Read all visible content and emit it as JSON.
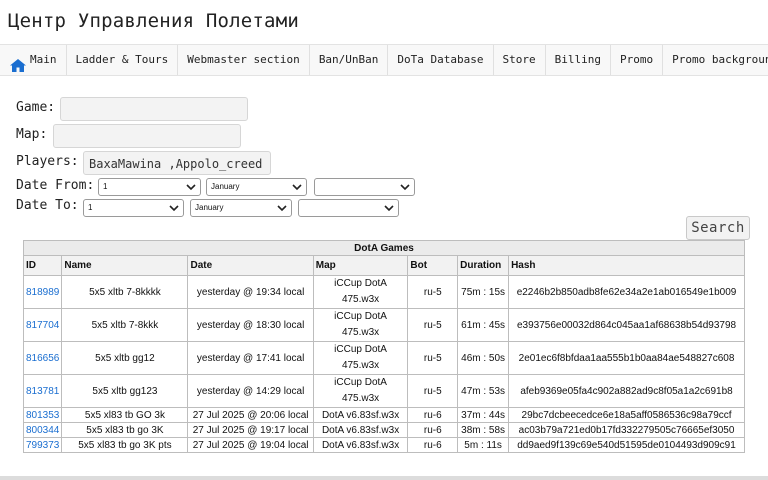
{
  "title": "Центр Управления Полетами",
  "nav": [
    {
      "label": "Main",
      "icon": "home-icon"
    },
    {
      "label": "Ladder & Tours"
    },
    {
      "label": "Webmaster section"
    },
    {
      "label": "Ban/UnBan"
    },
    {
      "label": "DoTa Database"
    },
    {
      "label": "Store"
    },
    {
      "label": "Billing"
    },
    {
      "label": "Promo"
    },
    {
      "label": "Promo background"
    }
  ],
  "form": {
    "game_label": "Game:",
    "game_value": "",
    "map_label": "Map:",
    "map_value": "",
    "players_label": "Players:",
    "players_value": "BaxaMawina ,Appolo_creed",
    "date_from_label": "Date From:",
    "date_to_label": "Date To:",
    "date_from": {
      "day": "1",
      "month": "January",
      "year": ""
    },
    "date_to": {
      "day": "1",
      "month": "January",
      "year": ""
    },
    "search_label": "Search"
  },
  "table": {
    "caption": "DotA Games",
    "headers": [
      "ID",
      "Name",
      "Date",
      "Map",
      "Bot",
      "Duration",
      "Hash"
    ],
    "rows": [
      {
        "id": "818989",
        "name": "5x5 xltb 7-8kkkk",
        "date": "yesterday @ 19:34 local",
        "map1": "iCCup DotA",
        "map2": "475.w3x",
        "bot": "ru-5",
        "duration": "75m : 15s",
        "hash": "e2246b2b850adb8fe62e34a2e1ab016549e1b009"
      },
      {
        "id": "817704",
        "name": "5x5 xltb 7-8kkk",
        "date": "yesterday @ 18:30 local",
        "map1": "iCCup DotA",
        "map2": "475.w3x",
        "bot": "ru-5",
        "duration": "61m : 45s",
        "hash": "e393756e00032d864c045aa1af68638b54d93798"
      },
      {
        "id": "816656",
        "name": "5x5 xltb gg12",
        "date": "yesterday @ 17:41 local",
        "map1": "iCCup DotA",
        "map2": "475.w3x",
        "bot": "ru-5",
        "duration": "46m : 50s",
        "hash": "2e01ec6f8bfdaa1aa555b1b0aa84ae548827c608"
      },
      {
        "id": "813781",
        "name": "5x5 xltb gg123",
        "date": "yesterday @ 14:29 local",
        "map1": "iCCup DotA",
        "map2": "475.w3x",
        "bot": "ru-5",
        "duration": "47m : 53s",
        "hash": "afeb9369e05fa4c902a882ad9c8f05a1a2c691b8"
      },
      {
        "id": "801353",
        "name": "5x5 xl83 tb GO 3k",
        "date": "27 Jul 2025 @ 20:06 local",
        "map1": "DotA v6.83sf.w3x",
        "map2": "",
        "bot": "ru-6",
        "duration": "37m : 44s",
        "hash": "29bc7dcbeecedce6e18a5aff0586536c98a79ccf"
      },
      {
        "id": "800344",
        "name": "5x5 xl83 tb go 3K",
        "date": "27 Jul 2025 @ 19:17 local",
        "map1": "DotA v6.83sf.w3x",
        "map2": "",
        "bot": "ru-6",
        "duration": "38m : 58s",
        "hash": "ac03b79a721ed0b17fd332279505c76665ef3050"
      },
      {
        "id": "799373",
        "name": "5x5 xl83 tb go 3K pts",
        "date": "27 Jul 2025 @ 19:04 local",
        "map1": "DotA v6.83sf.w3x",
        "map2": "",
        "bot": "ru-6",
        "duration": "5m : 11s",
        "hash": "dd9aed9f139c69e540d51595de0104493d909c91"
      }
    ]
  },
  "colors": {
    "link": "#1a6ed0",
    "home_icon": "#1a6ed0"
  }
}
